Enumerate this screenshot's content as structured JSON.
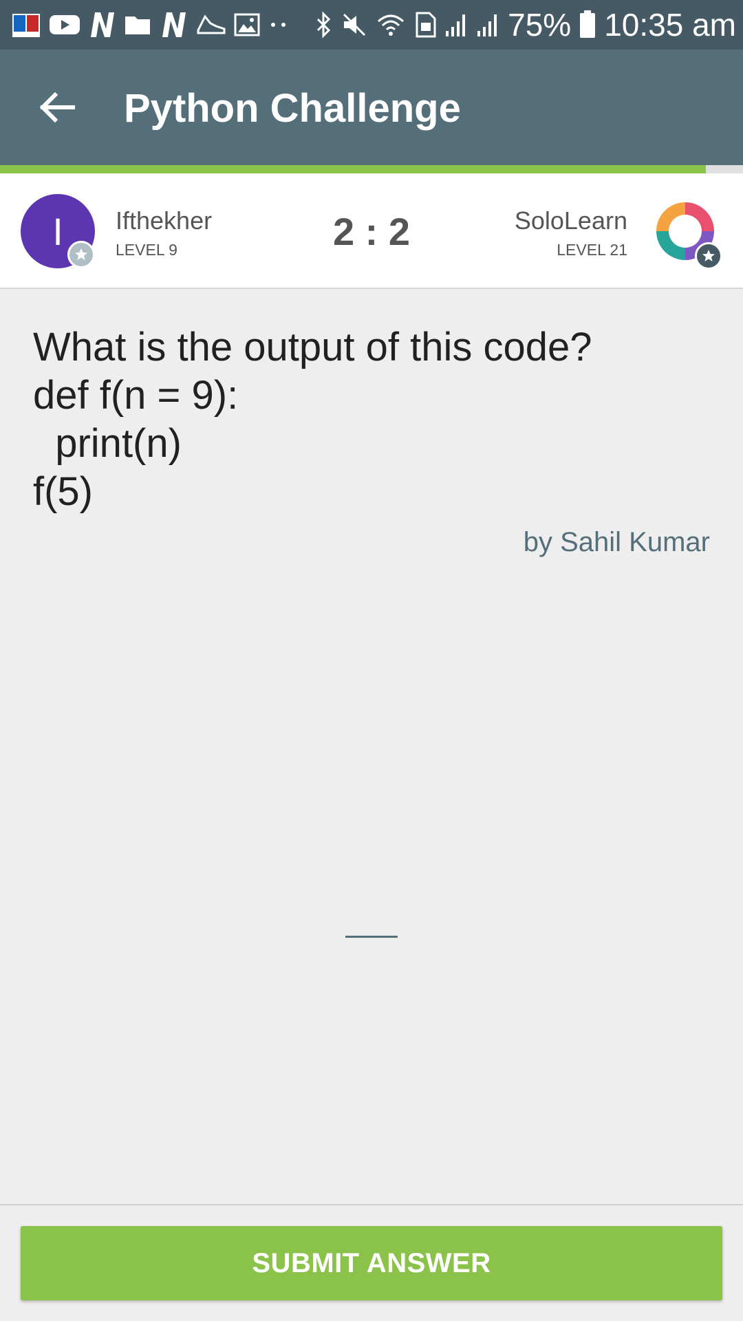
{
  "status_bar": {
    "battery": "75%",
    "time": "10:35 am",
    "left_icons": [
      "dictionary-app-icon",
      "youtube-icon",
      "n-app-icon",
      "folder-icon",
      "n-app-icon",
      "shoe-icon",
      "image-icon",
      "more-dots-icon"
    ],
    "right_icons": [
      "bluetooth-icon",
      "mute-icon",
      "wifi-icon",
      "sim-icon",
      "signal-icon",
      "signal-icon",
      "battery-icon"
    ]
  },
  "app_bar": {
    "title": "Python Challenge",
    "back_icon": "arrow-back-icon",
    "progress_fraction": 0.95
  },
  "players": {
    "left": {
      "initial": "I",
      "name": "Ifthekher",
      "level": "LEVEL 9"
    },
    "score": "2 : 2",
    "right": {
      "name": "SoloLearn",
      "level": "LEVEL 21"
    }
  },
  "question": {
    "text": "What is the output of this code?\ndef f(n = 9):\n  print(n)\nf(5)",
    "author": "by Sahil Kumar",
    "answer_value": ""
  },
  "submit": {
    "label": "SUBMIT ANSWER"
  },
  "colors": {
    "status_bar": "#455a64",
    "app_bar": "#546e7a",
    "accent_green": "#8bc34a",
    "avatar_purple": "#5e35b1"
  }
}
